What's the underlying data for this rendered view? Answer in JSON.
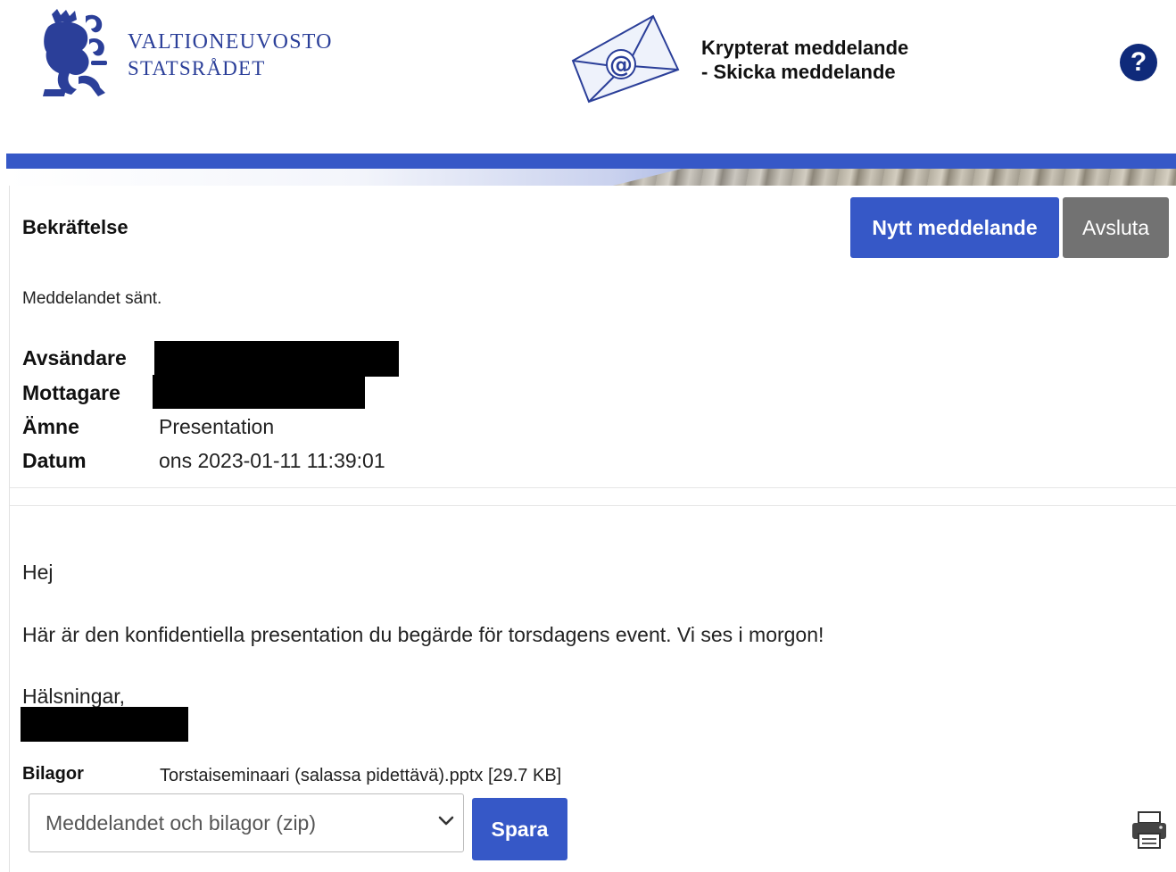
{
  "header": {
    "org_line1": "VALTIONEUVOSTO",
    "org_line2": "STATSRÅDET",
    "title_line1": "Krypterat meddelande",
    "title_line2": "- Skicka meddelande",
    "help_label": "?"
  },
  "toolbar": {
    "section_title": "Bekräftelse",
    "new_message_label": "Nytt meddelande",
    "exit_label": "Avsluta"
  },
  "status_message": "Meddelandet sänt.",
  "meta": {
    "sender_label": "Avsändare",
    "recipient_label": "Mottagare",
    "subject_label": "Ämne",
    "subject_value": "Presentation",
    "date_label": "Datum",
    "date_value": "ons 2023-01-11 11:39:01"
  },
  "message": {
    "greeting": "Hej",
    "body": "Här är den konfidentiella presentation du begärde för torsdagens event. Vi ses i morgon!",
    "closing": "Hälsningar,"
  },
  "attachments": {
    "label": "Bilagor",
    "file": "Torstaiseminaari (salassa pidettävä).pptx [29.7 KB]"
  },
  "download": {
    "select_value": "Meddelandet och bilagor (zip)",
    "save_label": "Spara"
  },
  "colors": {
    "brand_blue": "#3658c7",
    "logo_blue": "#2b3f99",
    "help_blue": "#0f2a7a",
    "exit_gray": "#727272"
  },
  "icons": [
    "lion-crest-logo-icon",
    "encrypted-envelope-icon",
    "help-icon",
    "chevron-down-icon",
    "printer-icon"
  ]
}
